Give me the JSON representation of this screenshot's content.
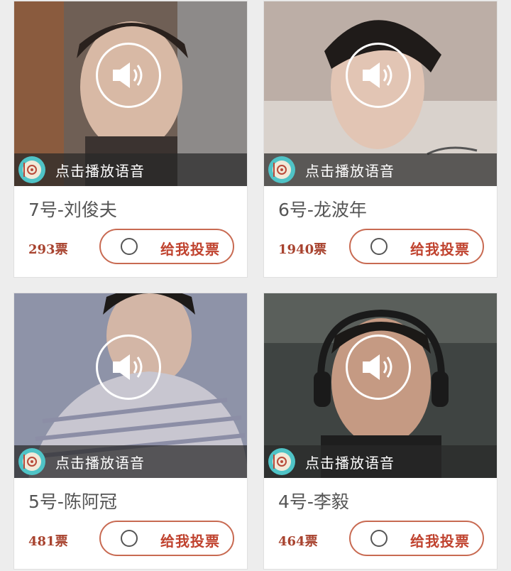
{
  "cards": [
    {
      "name": "7号-刘俊夫",
      "votes": "293票",
      "audio_label": "点击播放语音",
      "vote_label": "给我投票",
      "photo_tone": "#7a6a60"
    },
    {
      "name": "6号-龙波年",
      "votes": "1940票",
      "audio_label": "点击播放语音",
      "vote_label": "给我投票",
      "photo_tone": "#b9a79c"
    },
    {
      "name": "5号-陈阿冠",
      "votes": "481票",
      "audio_label": "点击播放语音",
      "vote_label": "给我投票",
      "photo_tone": "#8a8fa3"
    },
    {
      "name": "4号-李毅",
      "votes": "464票",
      "audio_label": "点击播放语音",
      "vote_label": "给我投票",
      "photo_tone": "#4a4a48"
    }
  ],
  "icons": {
    "play": "speaker-icon",
    "disc": "vinyl-disc-icon",
    "radio": "radio-circle-icon"
  },
  "colors": {
    "vote_text": "#c0432f",
    "votes_count": "#a8432f",
    "disc": "#4fc3c6"
  }
}
